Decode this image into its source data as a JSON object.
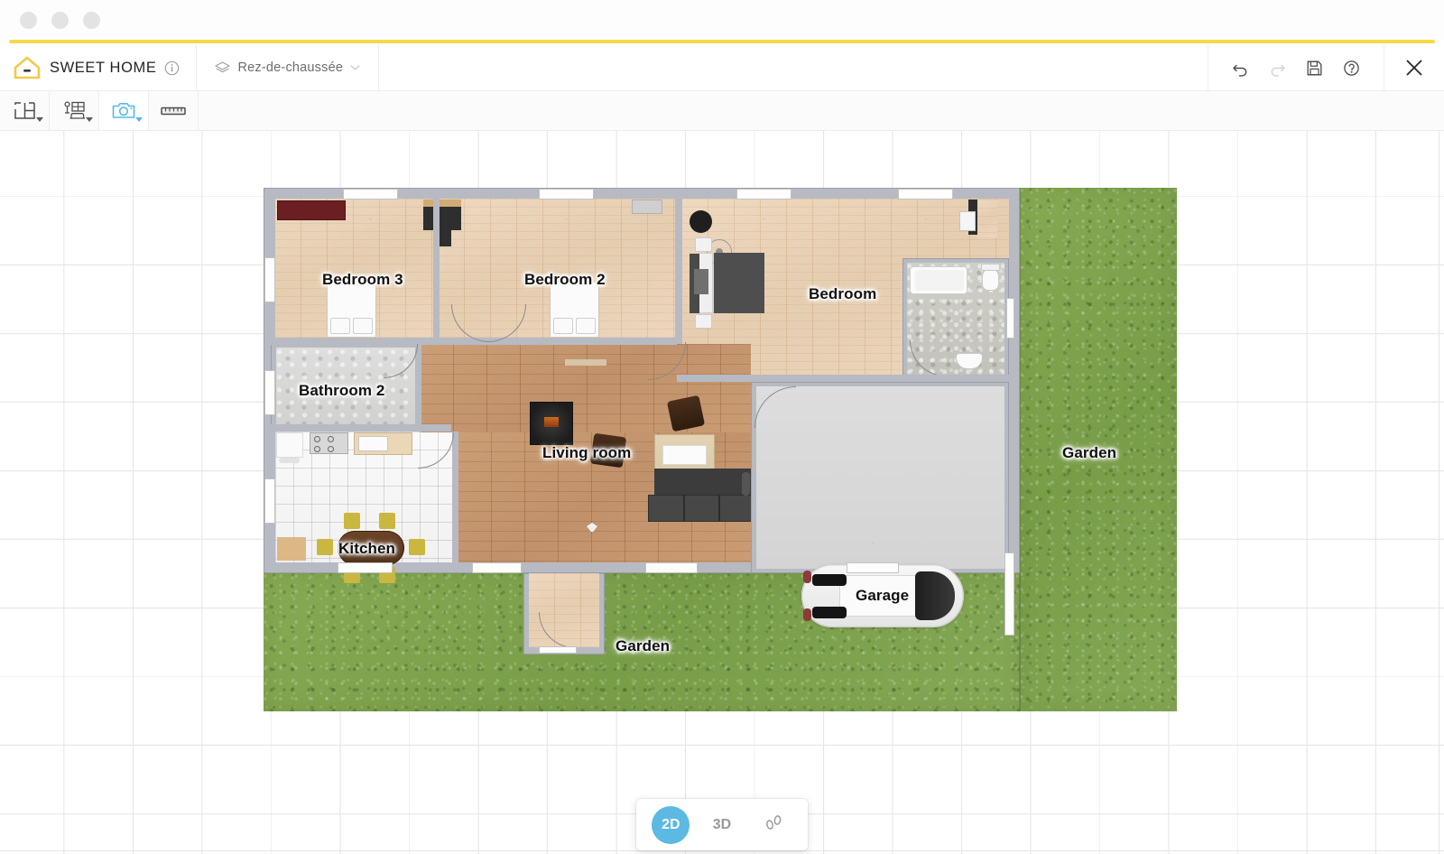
{
  "window": {
    "dots": [
      "close-dot",
      "minimize-dot",
      "zoom-dot"
    ],
    "accent_color": "#f5d949"
  },
  "header": {
    "logo_icon": "house-icon",
    "title": "SWEET HOME",
    "info_icon": "info-icon",
    "layer": {
      "icon": "layers-icon",
      "label": "Rez-de-chaussée",
      "chevron_icon": "chevron-down-icon"
    },
    "actions": [
      {
        "name": "undo-button",
        "icon": "undo-arrow-icon",
        "enabled": true
      },
      {
        "name": "redo-button",
        "icon": "redo-arrow-icon",
        "enabled": false
      },
      {
        "name": "save-button",
        "icon": "floppy-disk-icon",
        "enabled": true
      },
      {
        "name": "help-button",
        "icon": "question-circle-icon",
        "enabled": true
      }
    ],
    "close_icon": "close-x-icon"
  },
  "toolbar": {
    "tools": [
      {
        "name": "floorplan-tool",
        "icon": "floorplan-icon",
        "has_caret": true,
        "active": false
      },
      {
        "name": "furniture-tool",
        "icon": "furniture-icon",
        "has_caret": true,
        "active": false
      },
      {
        "name": "camera-tool",
        "icon": "camera-icon",
        "has_caret": true,
        "active": true
      },
      {
        "name": "measure-tool",
        "icon": "ruler-icon",
        "has_caret": false,
        "active": false
      }
    ],
    "accent_color": "#55b9e8"
  },
  "canvas": {
    "grid_color": "#e6e6e6",
    "grid_size_px": 76,
    "background": "#ffffff"
  },
  "plan": {
    "rooms": [
      {
        "name": "bedroom-3",
        "label": "Bedroom 3",
        "floor": "wood-light"
      },
      {
        "name": "bedroom-2",
        "label": "Bedroom 2",
        "floor": "wood-light"
      },
      {
        "name": "bedroom-1",
        "label": "Bedroom",
        "floor": "wood-light"
      },
      {
        "name": "bathroom-2",
        "label": "Bathroom 2",
        "floor": "tile-grey"
      },
      {
        "name": "kitchen",
        "label": "Kitchen",
        "floor": "tile-white"
      },
      {
        "name": "living-room",
        "label": "Living room",
        "floor": "wood-dark"
      },
      {
        "name": "garage",
        "label": "Garage",
        "floor": "concrete"
      },
      {
        "name": "garden-east",
        "label": "Garden",
        "floor": "grass"
      },
      {
        "name": "garden-south",
        "label": "Garden",
        "floor": "grass"
      }
    ],
    "wall_color": "#b7bac3",
    "grass_color": "#7fa34e",
    "furniture": [
      "wardrobe",
      "desk",
      "bed",
      "double-bed",
      "nightstand",
      "lamp",
      "dining-table",
      "dining-chair",
      "stove",
      "sink",
      "counter",
      "fireplace",
      "armchair",
      "sofa",
      "coffee-table",
      "rug",
      "bathtub",
      "toilet",
      "washbasin",
      "car"
    ]
  },
  "view_switcher": {
    "items": [
      {
        "name": "view-2d",
        "label": "2D",
        "active": true
      },
      {
        "name": "view-3d",
        "label": "3D",
        "active": false
      },
      {
        "name": "view-walkthrough",
        "label": "",
        "icon": "footsteps-icon",
        "active": false
      }
    ],
    "active_color": "#5cb9e3"
  }
}
